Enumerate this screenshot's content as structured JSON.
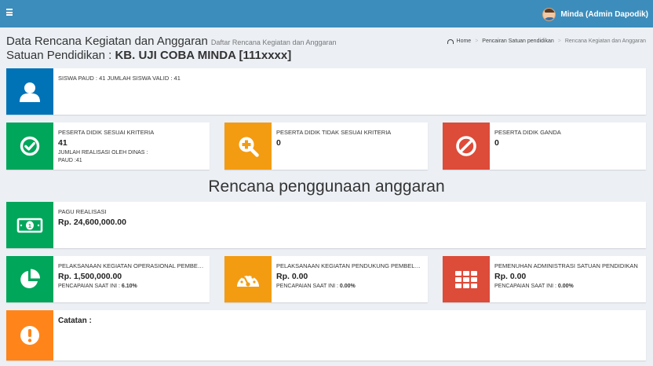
{
  "topbar": {
    "menu_icon": "hamburger-icon",
    "user_name": "Minda (Admin Dapodik)"
  },
  "header": {
    "title": "Data Rencana Kegiatan dan Anggaran",
    "subtitle": "Daftar Rencana Kegiatan dan Anggaran",
    "school_label": "Satuan Pendidikan :",
    "school_name": "KB. UJI COBA MINDA [111xxxx]"
  },
  "breadcrumb": {
    "items": [
      "Home",
      "Pencairan Satuan pendidikan",
      "Rencana Kegiatan dan Anggaran"
    ]
  },
  "siswa": {
    "text": "SISWA PAUD : 41 JUMLAH SISWA VALID : 41",
    "icon": "user-icon",
    "color": "#0073b7"
  },
  "cards": [
    {
      "caption": "PESERTA DIDIK SESUAI KRITERIA",
      "value": "41",
      "extra1": "JUMLAH REALISASI OLEH DINAS :",
      "extra2": "PAUD :41",
      "icon": "check-circle-icon",
      "color": "#00a65a"
    },
    {
      "caption": "PESERTA DIDIK TIDAK SESUAI KRITERIA",
      "value": "0",
      "icon": "search-plus-icon",
      "color": "#f39c12"
    },
    {
      "caption": "PESERTA DIDIK GANDA",
      "value": "0",
      "icon": "ban-icon",
      "color": "#dd4b39"
    }
  ],
  "section_title": "Rencana penggunaan anggaran",
  "pagu": {
    "caption": "PAGU REALISASI",
    "value": "Rp. 24,600,000.00",
    "icon": "money-icon",
    "color": "#00a65a"
  },
  "budget": [
    {
      "caption": "PELAKSANAAN KEGIATAN OPERASIONAL PEMBELAJARAN",
      "value": "Rp. 1,500,000.00",
      "progress_label": "PENCAPAIAN SAAT INI :",
      "progress": "6.10%",
      "icon": "pie-chart-icon",
      "color": "#00a65a"
    },
    {
      "caption": "PELAKSANAAN KEGIATAN PENDUKUNG PEMBELAJARAN",
      "value": "Rp. 0.00",
      "progress_label": "PENCAPAIAN SAAT INI :",
      "progress": "0.00%",
      "icon": "dashboard-gauge-icon",
      "color": "#f39c12"
    },
    {
      "caption": "PEMENUHAN ADMINISTRASI SATUAN PENDIDIKAN",
      "value": "Rp. 0.00",
      "progress_label": "PENCAPAIAN SAAT INI :",
      "progress": "0.00%",
      "icon": "grid-icon",
      "color": "#dd4b39"
    }
  ],
  "catatan": {
    "label": "Catatan :",
    "icon": "exclamation-circle-icon",
    "color": "#ff851b"
  }
}
